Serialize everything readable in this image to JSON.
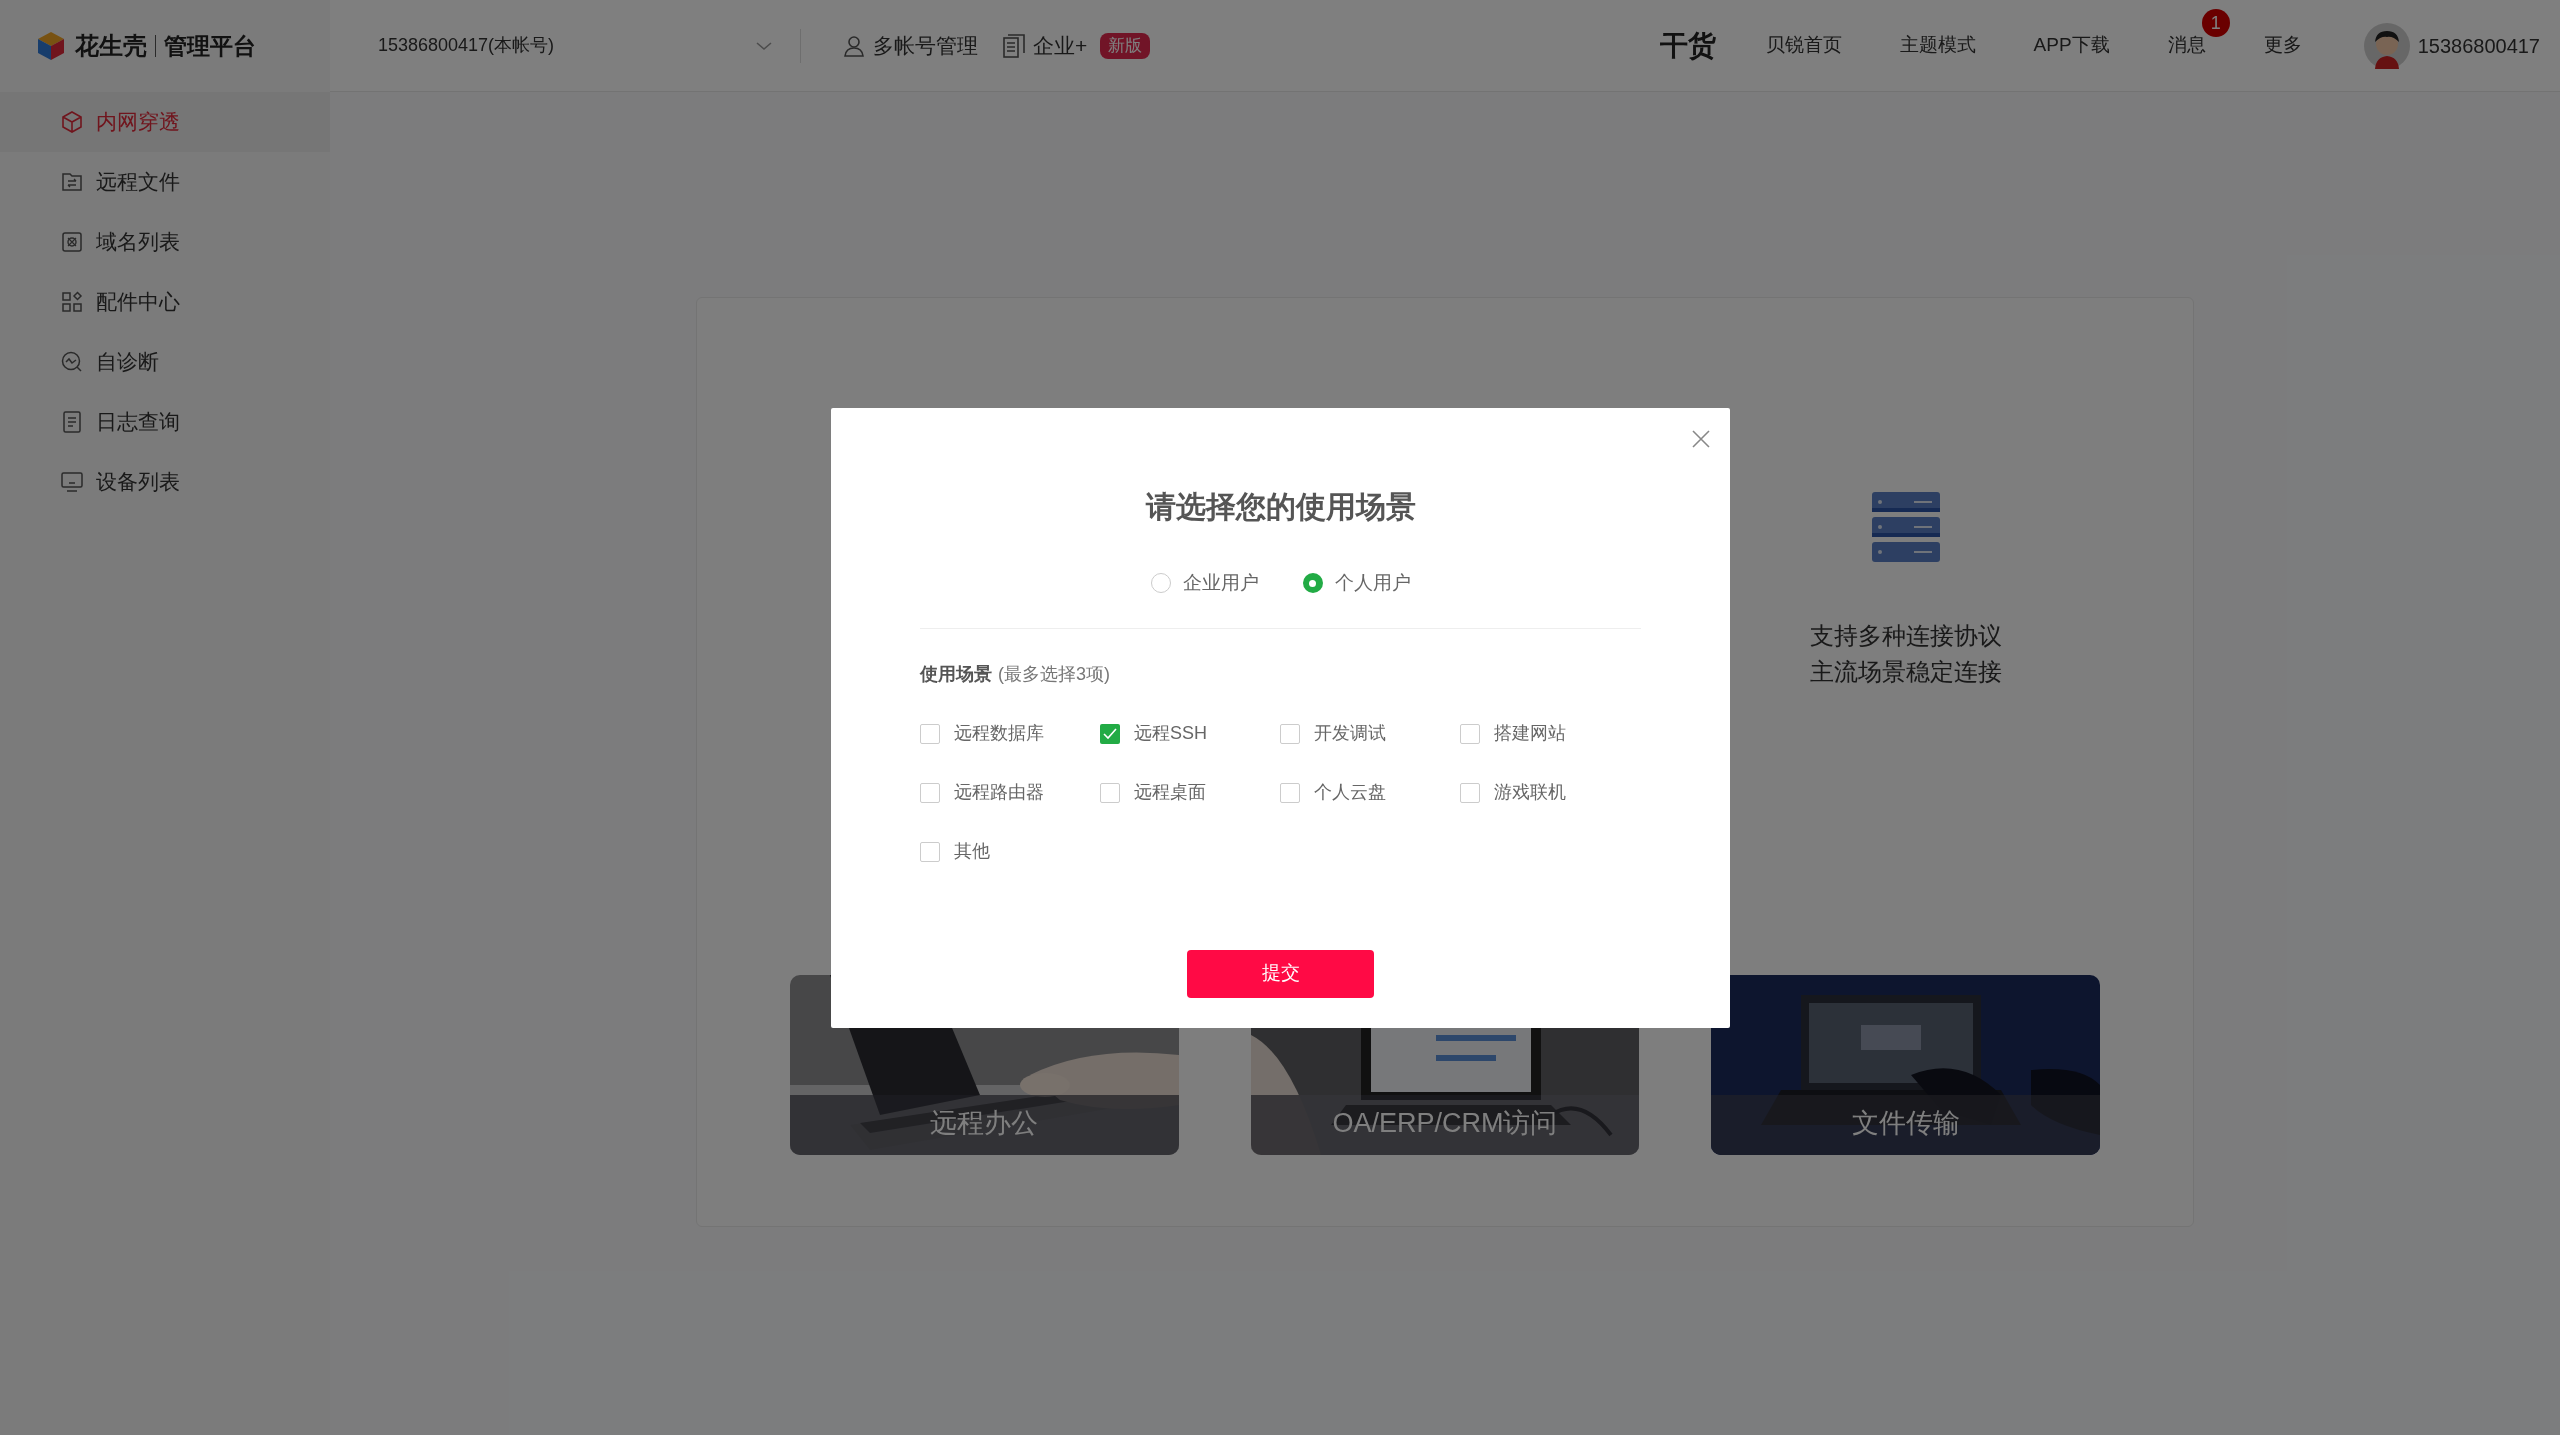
{
  "brand": {
    "name": "花生壳",
    "product": "管理平台"
  },
  "account_select": {
    "value": "15386800417(本帐号)"
  },
  "header_links": [
    {
      "label": "多帐号管理",
      "kind": "user"
    },
    {
      "label": "企业+",
      "kind": "enterprise",
      "badge": "新版"
    }
  ],
  "nav_right": [
    {
      "label": "干货",
      "kind": "logo"
    },
    {
      "label": "贝锐首页",
      "kind": "link"
    },
    {
      "label": "主题模式",
      "kind": "link"
    },
    {
      "label": "APP下载",
      "kind": "link"
    },
    {
      "label": "消息",
      "kind": "link",
      "badge": "1"
    },
    {
      "label": "更多",
      "kind": "link"
    }
  ],
  "user": {
    "name": "15386800417"
  },
  "sidebar": {
    "items": [
      {
        "label": "内网穿透",
        "selected": true
      },
      {
        "label": "远程文件",
        "selected": false
      },
      {
        "label": "域名列表",
        "selected": false
      },
      {
        "label": "配件中心",
        "selected": false
      },
      {
        "label": "自诊断",
        "selected": false
      },
      {
        "label": "日志查询",
        "selected": false
      },
      {
        "label": "设备列表",
        "selected": false
      }
    ]
  },
  "main": {
    "feature": {
      "lines": [
        "支持多种连接协议",
        "主流场景稳定连接"
      ]
    },
    "scenarios": [
      {
        "caption": "远程办公"
      },
      {
        "caption": "OA/ERP/CRM访问"
      },
      {
        "caption": "文件传输"
      }
    ]
  },
  "modal": {
    "title": "请选择您的使用场景",
    "user_types": [
      {
        "label": "企业用户",
        "selected": false
      },
      {
        "label": "个人用户",
        "selected": true
      }
    ],
    "section_label": "使用场景",
    "section_hint": "(最多选择3项)",
    "options": [
      {
        "label": "远程数据库",
        "checked": false
      },
      {
        "label": "远程SSH",
        "checked": true
      },
      {
        "label": "开发调试",
        "checked": false
      },
      {
        "label": "搭建网站",
        "checked": false
      },
      {
        "label": "远程路由器",
        "checked": false
      },
      {
        "label": "远程桌面",
        "checked": false
      },
      {
        "label": "个人云盘",
        "checked": false
      },
      {
        "label": "游戏联机",
        "checked": false
      },
      {
        "label": "其他",
        "checked": false
      }
    ],
    "submit": "提交"
  }
}
